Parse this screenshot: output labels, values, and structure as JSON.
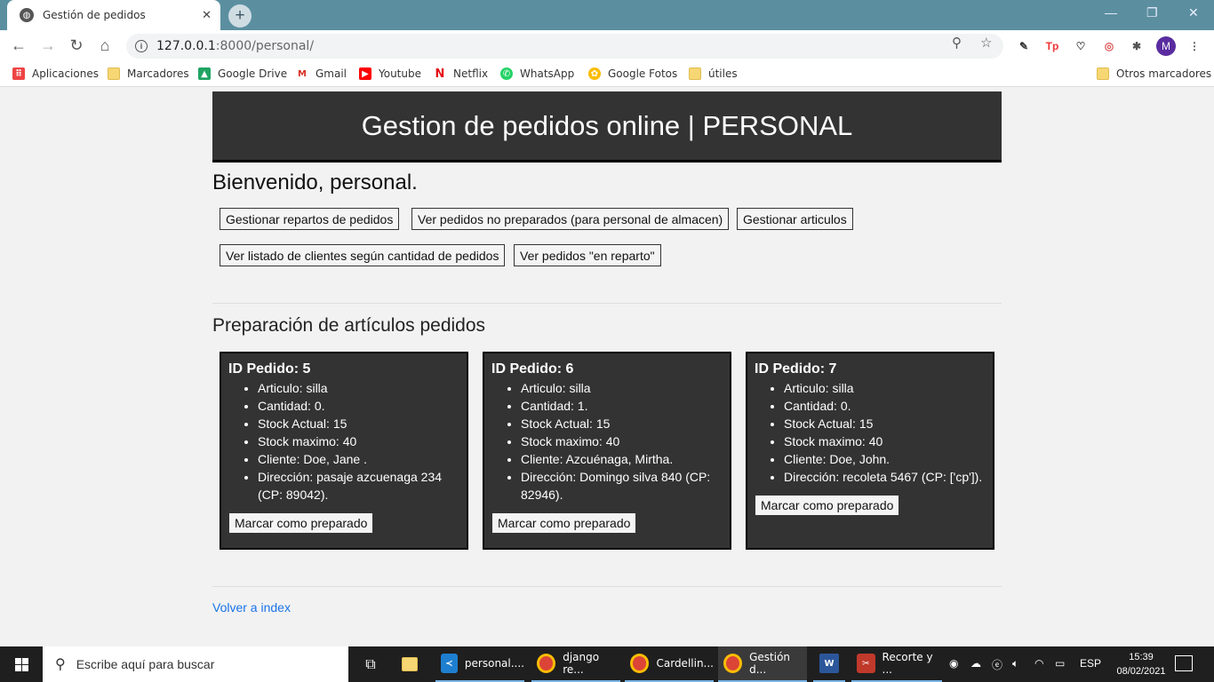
{
  "browser": {
    "tab_title": "Gestión de pedidos",
    "url_host": "127.0.0.1",
    "url_rest": ":8000/personal/",
    "profile_initial": "M",
    "bookmarks": [
      "Aplicaciones",
      "Marcadores",
      "Google Drive",
      "Gmail",
      "Youtube",
      "Netflix",
      "WhatsApp",
      "Google Fotos",
      "útiles"
    ],
    "other_bookmarks": "Otros marcadores"
  },
  "page": {
    "header_title": "Gestion de pedidos online | PERSONAL",
    "welcome": "Bienvenido, personal.",
    "nav_buttons": [
      "Gestionar repartos de pedidos",
      "Ver pedidos no preparados (para personal de almacen)",
      "Gestionar articulos",
      "Ver listado de clientes según cantidad de pedidos",
      "Ver pedidos \"en reparto\""
    ],
    "section_title": "Preparación de artículos pedidos",
    "orders": [
      {
        "title": "ID Pedido: 5",
        "articulo": "Articulo: silla",
        "cantidad": "Cantidad: 0.",
        "stock_actual": "Stock Actual: 15",
        "stock_maximo": "Stock maximo: 40",
        "cliente": "Cliente: Doe, Jane .",
        "direccion": "Dirección: pasaje azcuenaga 234 (CP: 89042).",
        "button": "Marcar como preparado"
      },
      {
        "title": "ID Pedido: 6",
        "articulo": "Articulo: silla",
        "cantidad": "Cantidad: 1.",
        "stock_actual": "Stock Actual: 15",
        "stock_maximo": "Stock maximo: 40",
        "cliente": "Cliente: Azcuénaga, Mirtha.",
        "direccion": "Dirección: Domingo silva 840 (CP: 82946).",
        "button": "Marcar como preparado"
      },
      {
        "title": "ID Pedido: 7",
        "articulo": "Articulo: silla",
        "cantidad": "Cantidad: 0.",
        "stock_actual": "Stock Actual: 15",
        "stock_maximo": "Stock maximo: 40",
        "cliente": "Cliente: Doe, John.",
        "direccion": "Dirección: recoleta 5467 (CP: ['cp']).",
        "button": "Marcar como preparado"
      }
    ],
    "back_link": "Volver a index"
  },
  "taskbar": {
    "search_placeholder": "Escribe aquí para buscar",
    "items": [
      "personal....",
      "django re...",
      "Cardellin...",
      "Gestión d...",
      "Recorte y ..."
    ],
    "language": "ESP",
    "time": "15:39",
    "date": "08/02/2021"
  },
  "colors": {
    "tabbar": "#5b8fa0",
    "header_bg": "#333333",
    "card_bg": "#333333",
    "link": "#1a73e8"
  }
}
